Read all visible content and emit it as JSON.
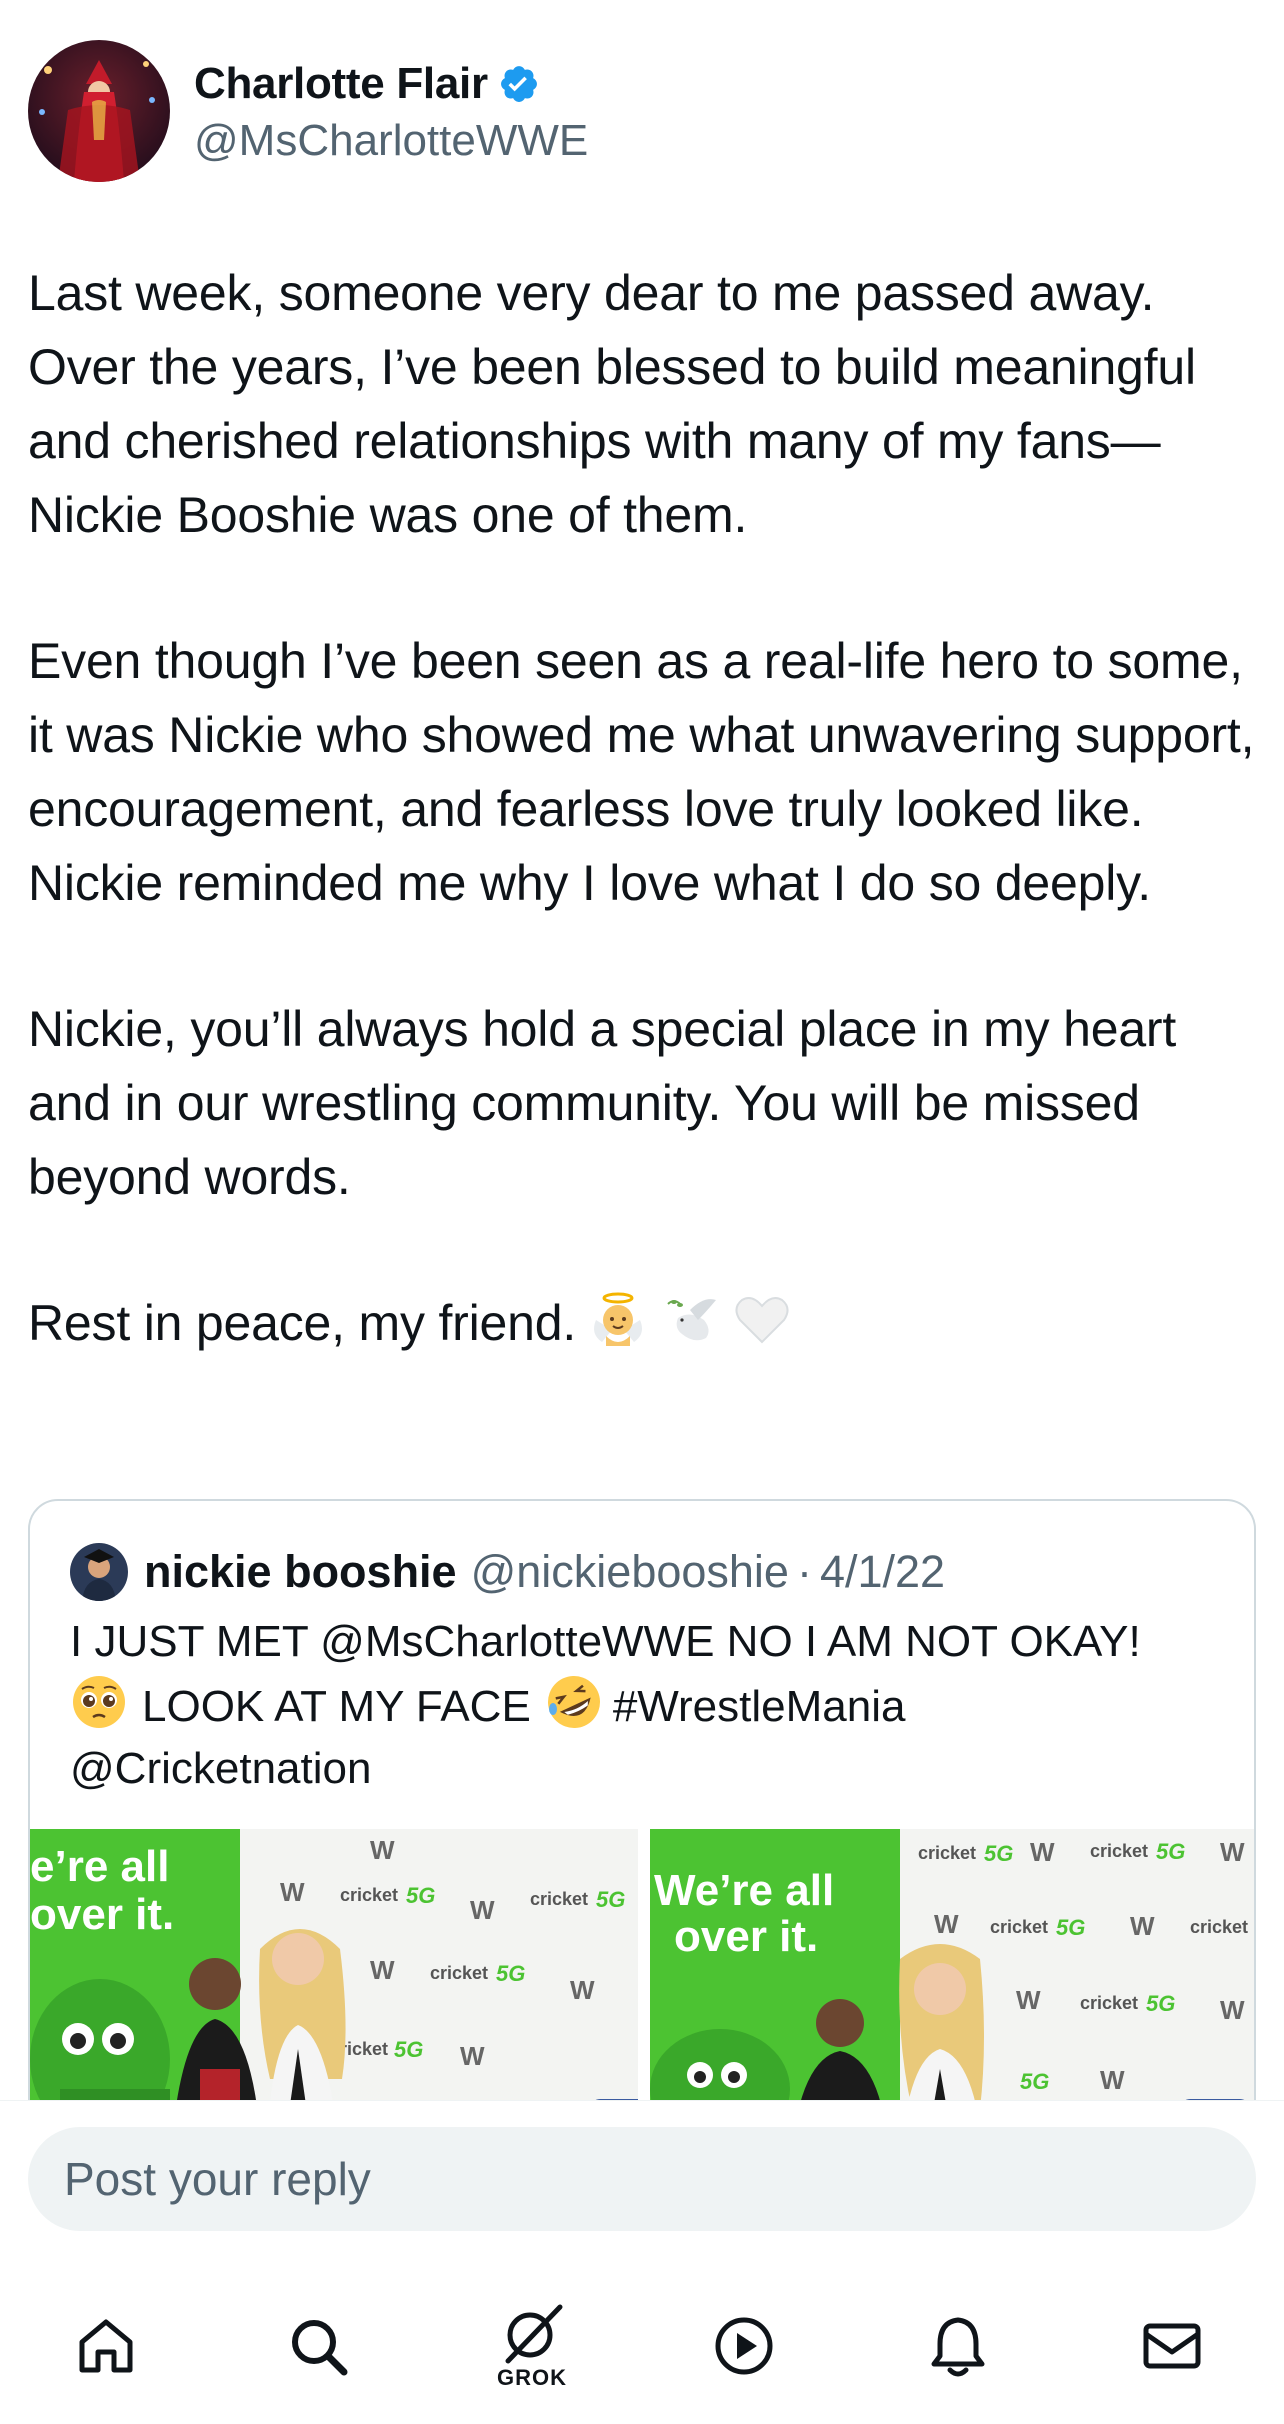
{
  "author": {
    "display_name": "Charlotte Flair",
    "handle": "@MsCharlotteWWE",
    "verified": true,
    "verified_color": "#1d9bf0"
  },
  "tweet": {
    "paragraphs": [
      "Last week, someone very dear to me passed away. Over the years, I’ve been blessed to build meaningful and cherished relationships with many of my fans—Nickie Booshie was one of them.",
      "Even though I’ve been seen as a real-life hero to some, it was Nickie who showed me what unwavering support, encouragement, and fearless love truly looked like. Nickie reminded me why I love what I do so deeply.",
      "Nickie, you’ll always hold a special place in my heart and in our wrestling community. You will be missed beyond words.",
      "Rest in peace, my friend."
    ],
    "closing_emojis": [
      "baby-angel-emoji",
      "dove-emoji",
      "white-heart-emoji"
    ]
  },
  "quoted_tweet": {
    "display_name": "nickie booshie",
    "handle": "@nickiebooshie",
    "separator": "·",
    "date": "4/1/22",
    "line1": "I JUST MET @MsCharlotteWWE NO I AM NOT OKAY!",
    "line2": "LOOK AT MY FACE",
    "line2_hashtag": "#WrestleMania",
    "line3": "@Cricketnation",
    "emojis": [
      "pleading-face-emoji",
      "rofl-emoji"
    ],
    "photos": [
      {
        "banner_line1": "e’re all",
        "banner_line2": "over it.",
        "sponsor": "cricket 5G"
      },
      {
        "banner_line1": "We’re all",
        "banner_line2": "over it.",
        "sponsor": "cricket 5G"
      }
    ]
  },
  "reply": {
    "placeholder": "Post your reply"
  },
  "nav": {
    "items": [
      "home",
      "search",
      "grok",
      "video",
      "notifications",
      "messages"
    ],
    "grok_label": "GROK"
  },
  "colors": {
    "text": "#0f1419",
    "secondary": "#536471",
    "border": "#cfd9de",
    "reply_bg": "#eff3f4",
    "cricket_green": "#4cc332"
  }
}
